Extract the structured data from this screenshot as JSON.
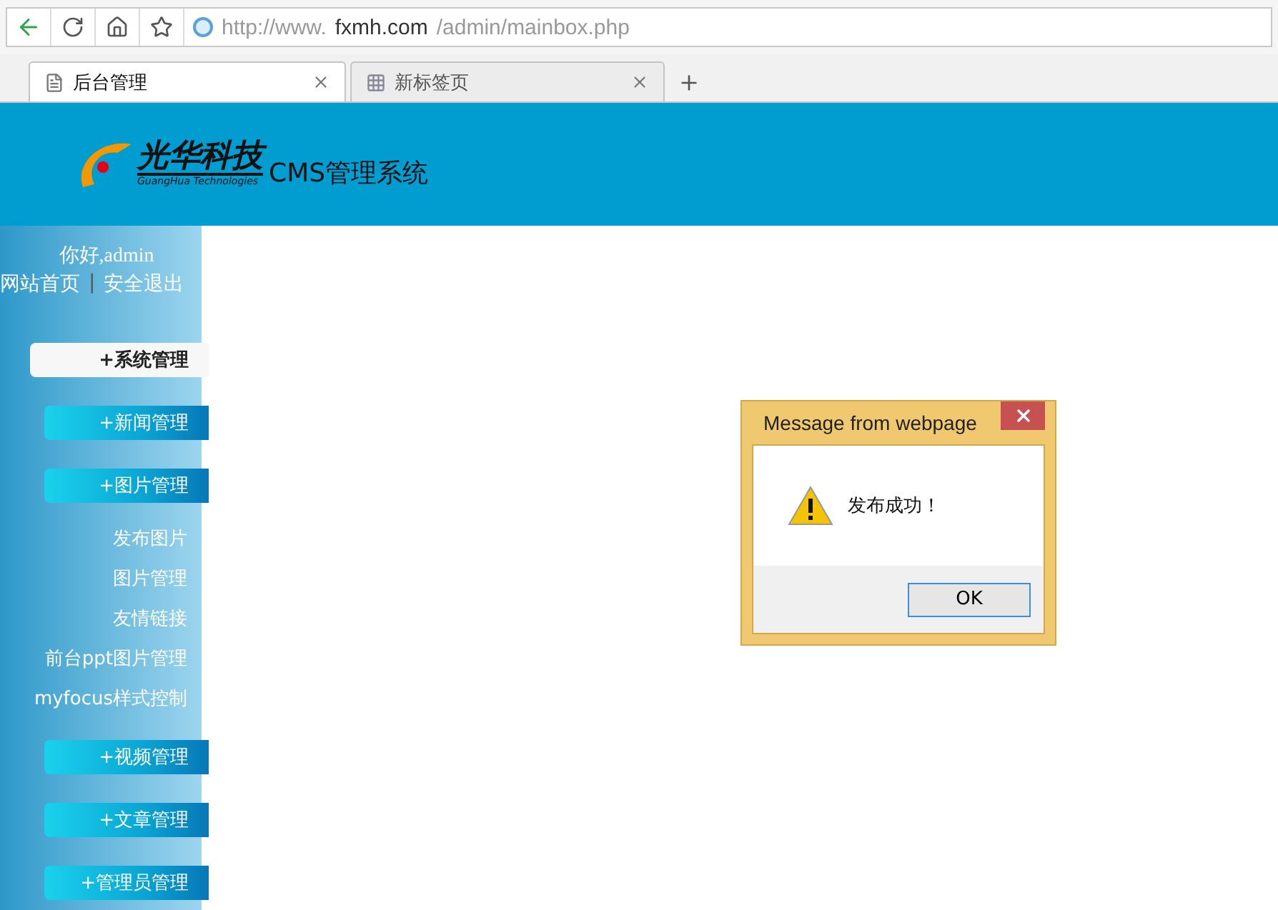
{
  "browser": {
    "url": {
      "scheme": "http://www.",
      "domain": "fxmh.com",
      "path": "/admin/mainbox.php"
    },
    "tabs": [
      {
        "label": "后台管理",
        "selected": true
      },
      {
        "label": "新标签页",
        "selected": false
      }
    ]
  },
  "header": {
    "logo_text": "光华科技",
    "logo_subtitle": "GuangHua Technologies",
    "system_title": "CMS管理系统"
  },
  "sidebar": {
    "greeting": "你好,admin",
    "links": [
      "网站首页",
      "安全退出"
    ],
    "separator": "|",
    "menu": [
      {
        "label": "+系统管理",
        "selected": true
      },
      {
        "label": "+新闻管理",
        "selected": false
      },
      {
        "label": "+图片管理",
        "selected": false,
        "children": [
          "发布图片",
          "图片管理",
          "友情链接",
          "前台ppt图片管理",
          "myfocus样式控制"
        ]
      },
      {
        "label": "+视频管理",
        "selected": false
      },
      {
        "label": "+文章管理",
        "selected": false
      },
      {
        "label": "+管理员管理",
        "selected": false
      }
    ]
  },
  "dialog": {
    "title": "Message from webpage",
    "message": "发布成功！",
    "button": "OK"
  }
}
